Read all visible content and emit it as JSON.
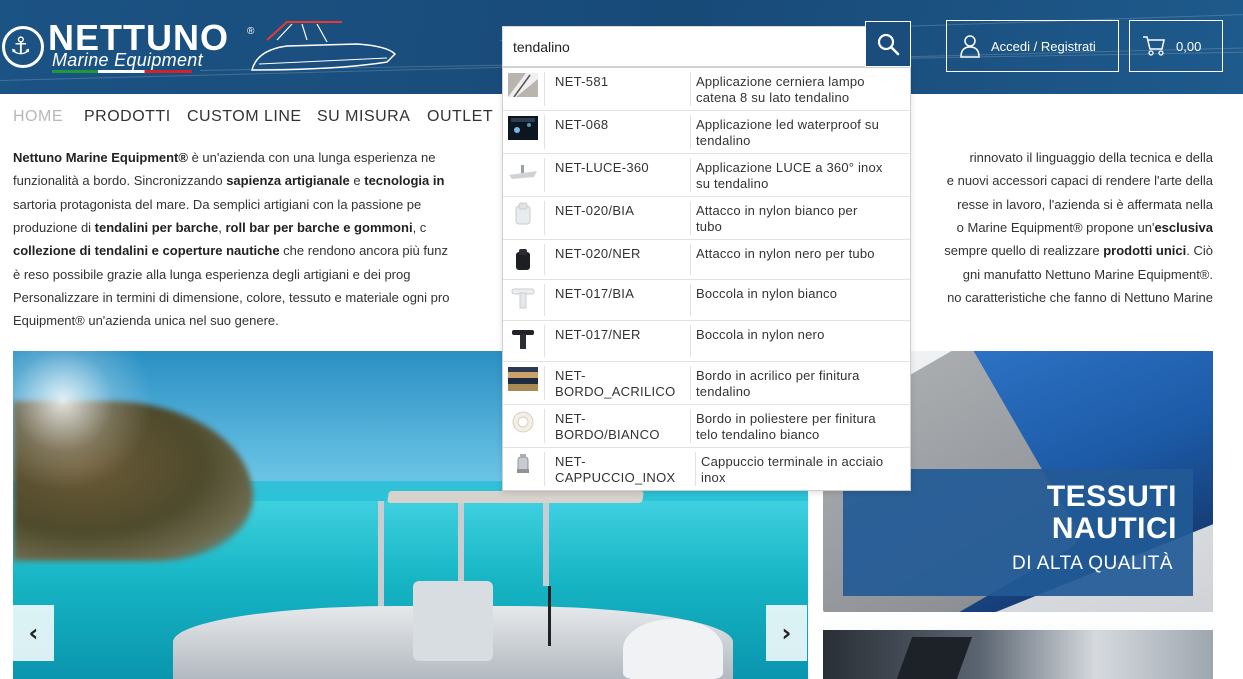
{
  "colors": {
    "header_bg": "#1a4d7c",
    "accent": "#1a4d7c",
    "nav_active": "#b8b8b8"
  },
  "header": {
    "logo": {
      "brand": "NETTUNO",
      "registered": "®",
      "tagline": "Marine Equipment"
    },
    "search": {
      "value": "tendalino",
      "button_icon": "search-icon"
    },
    "login_label": "Accedi / Registrati",
    "login_icon": "user-icon",
    "cart_total": "0,00",
    "cart_icon": "cart-icon"
  },
  "nav": {
    "items": [
      {
        "label": "HOME",
        "active": true
      },
      {
        "label": "PRODOTTI"
      },
      {
        "label": "CUSTOM LINE"
      },
      {
        "label": "SU MISURA"
      },
      {
        "label": "OUTLET"
      }
    ]
  },
  "intro": {
    "line1_a": "Nettuno Marine Equipment®",
    "line1_b": " è un'azienda con una lunga esperienza ne",
    "line1_c": " rinnovato il linguaggio della tecnica e della",
    "line2_a": "funzionalità a bordo. Sincronizzando ",
    "line2_b": "sapienza artigianale",
    "line2_c": " e ",
    "line2_d": "tecnologia in",
    "line2_e": "e nuovi accessori capaci di rendere l'arte della",
    "line3_a": "sartoria protagonista del mare. Da semplici artigiani con la passione pe",
    "line3_b": "resse in lavoro, l'azienda si è affermata nella",
    "line4_a": "produzione di ",
    "line4_b": "tendalini per barche",
    "line4_c": ", ",
    "line4_d": "roll bar per barche e gommoni",
    "line4_e": ", c",
    "line4_f": "o Marine Equipment® propone un'",
    "line4_g": "esclusiva",
    "line5_a": "collezione di tendalini e coperture nautiche",
    "line5_b": " che rendono ancora più funz",
    "line5_c": " sempre quello di realizzare ",
    "line5_d": "prodotti unici",
    "line5_e": ". Ciò",
    "line6_a": "è reso possibile grazie alla lunga esperienza degli artigiani e dei prog",
    "line6_b": "gni manufatto Nettuno Marine Equipment®.",
    "line7_a": "Personalizzare in termini di dimensione, colore, tessuto e materiale ogni pro",
    "line7_b": "no caratteristiche che fanno di Nettuno Marine",
    "line8": "Equipment® un'azienda unica nel suo genere."
  },
  "carousel": {
    "prev_label": "‹",
    "next_label": "›"
  },
  "banner": {
    "line1": "TESSUTI",
    "line2": "NAUTICI",
    "line3": "DI ALTA QUALITÀ"
  },
  "autocomplete": {
    "results": [
      {
        "code": "NET-581",
        "desc_1": "Applicazione cerniera lampo",
        "desc_2": "catena 8 su lato tendalino"
      },
      {
        "code": "NET-068",
        "desc_1": "Applicazione led waterproof su",
        "desc_2": "tendalino"
      },
      {
        "code": "NET-LUCE-360",
        "desc_1": "Applicazione LUCE a 360° inox",
        "desc_2": "su tendalino"
      },
      {
        "code": "NET-020/BIA",
        "desc_1": "Attacco in nylon bianco per",
        "desc_2": "tubo"
      },
      {
        "code": "NET-020/NER",
        "desc_1": "Attacco in nylon nero per tubo",
        "desc_2": ""
      },
      {
        "code": "NET-017/BIA",
        "desc_1": "Boccola in nylon bianco",
        "desc_2": ""
      },
      {
        "code": "NET-017/NER",
        "desc_1": "Boccola in nylon nero",
        "desc_2": ""
      },
      {
        "code_1": "NET-",
        "code_2": "BORDO_ACRILICO",
        "desc_1": "Bordo in acrilico per finitura",
        "desc_2": "tendalino"
      },
      {
        "code_1": "NET-",
        "code_2": "BORDO/BIANCO",
        "desc_1": "Bordo in poliestere per finitura",
        "desc_2": "telo tendalino bianco"
      },
      {
        "code_1": "NET-",
        "code_2": "CAPPUCCIO_INOX",
        "desc_1": "Cappuccio terminale in acciaio",
        "desc_2": "inox"
      }
    ]
  }
}
